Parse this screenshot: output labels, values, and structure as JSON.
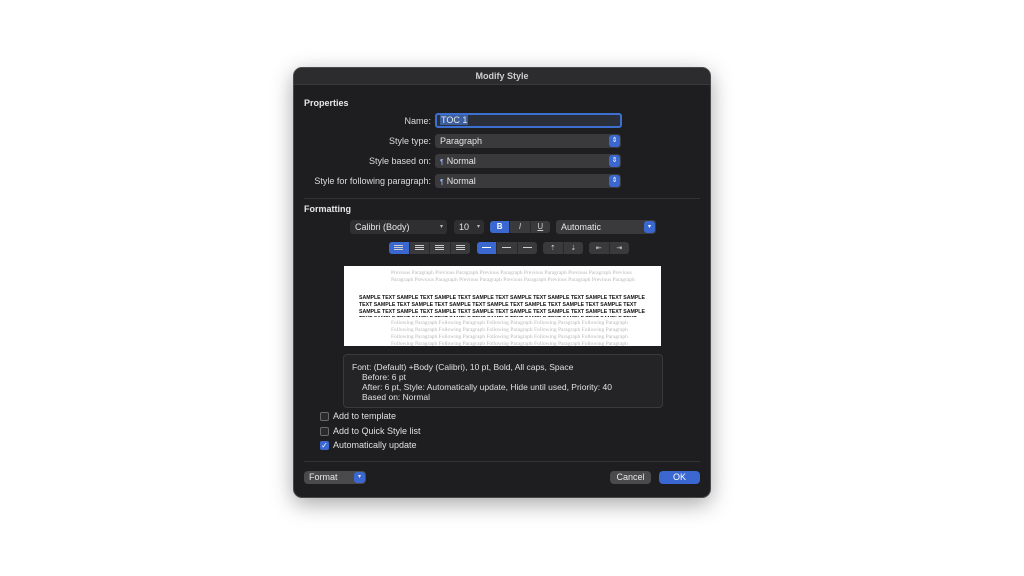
{
  "dialog": {
    "title": "Modify Style"
  },
  "properties": {
    "heading": "Properties",
    "name_label": "Name:",
    "name_value": "TOC 1",
    "style_type_label": "Style type:",
    "style_type_value": "Paragraph",
    "based_on_label": "Style based on:",
    "based_on_value": "Normal",
    "following_label": "Style for following paragraph:",
    "following_value": "Normal"
  },
  "formatting": {
    "heading": "Formatting",
    "font": "Calibri (Body)",
    "size": "10",
    "bold": "B",
    "italic": "I",
    "underline": "U",
    "color": "Automatic"
  },
  "preview": {
    "previous": "Previous Paragraph Previous Paragraph Previous Paragraph Previous Paragraph Previous Paragraph Previous Paragraph Previous Paragraph Previous Paragraph Previous Paragraph Previous Paragraph Previous Paragraph",
    "sample": "SAMPLE TEXT SAMPLE TEXT SAMPLE TEXT SAMPLE TEXT SAMPLE TEXT SAMPLE TEXT SAMPLE TEXT SAMPLE TEXT SAMPLE TEXT SAMPLE TEXT SAMPLE TEXT SAMPLE TEXT SAMPLE TEXT SAMPLE TEXT SAMPLE TEXT SAMPLE TEXT SAMPLE TEXT SAMPLE TEXT SAMPLE TEXT SAMPLE TEXT SAMPLE TEXT SAMPLE TEXT SAMPLE TEXT SAMPLE TEXT SAMPLE TEXT SAMPLE TEXT SAMPLE TEXT SAMPLE TEXT SAMPLE TEXT SAMPLE TEXT SAMPLE TEXT SAMPLE TEXT SAMPLE TEXT",
    "following": "Following Paragraph Following Paragraph Following Paragraph Following Paragraph Following Paragraph Following Paragraph Following Paragraph Following Paragraph Following Paragraph Following Paragraph Following Paragraph Following Paragraph Following Paragraph Following Paragraph Following Paragraph Following Paragraph Following Paragraph Following Paragraph Following Paragraph Following Paragraph Following Paragraph Following Paragraph Following Paragraph Following Paragraph Following Paragraph Following Paragraph Following Paragraph Following Paragraph"
  },
  "description": {
    "line1": "Font: (Default) +Body (Calibri), 10 pt, Bold, All caps, Space",
    "line2": "Before:  6 pt",
    "line3": "After:  6 pt, Style: Automatically update, Hide until used, Priority: 40",
    "line4": "Based on: Normal"
  },
  "options": {
    "add_to_template": "Add to template",
    "add_to_template_checked": false,
    "add_to_quick_style": "Add to Quick Style list",
    "add_to_quick_style_checked": false,
    "auto_update": "Automatically update",
    "auto_update_checked": true
  },
  "footer": {
    "format": "Format",
    "cancel": "Cancel",
    "ok": "OK"
  },
  "colors": {
    "accent": "#3a67d0",
    "panel": "#1e1e20"
  }
}
